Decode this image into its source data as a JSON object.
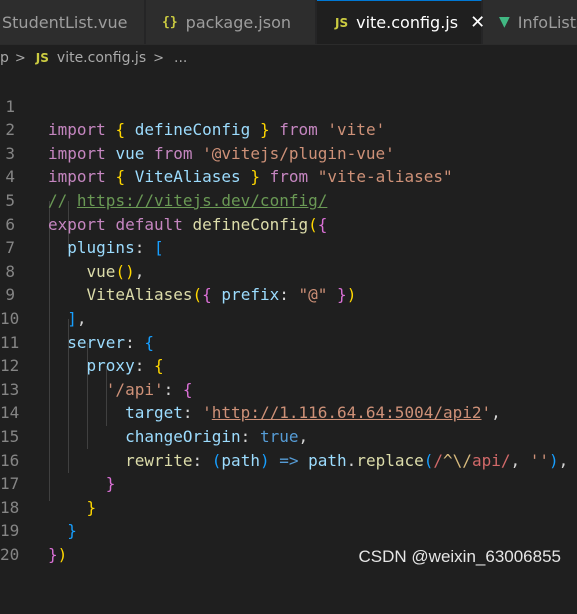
{
  "tabs": [
    {
      "label": "StudentList.vue",
      "icon": "vue-file-icon"
    },
    {
      "label": "package.json",
      "icon": "json-file-icon",
      "icon_glyph": "{}"
    },
    {
      "label": "vite.config.js",
      "icon": "js-file-icon",
      "icon_glyph": "JS",
      "active": true
    },
    {
      "label": "InfoLists",
      "icon": "vue-file-icon"
    }
  ],
  "close_glyph": "✕",
  "breadcrumb": {
    "folder": "p",
    "file_icon_glyph": "JS",
    "file": "vite.config.js",
    "more": "..."
  },
  "line_numbers": [
    "1",
    "2",
    "3",
    "4",
    "5",
    "6",
    "7",
    "8",
    "9",
    "10",
    "11",
    "12",
    "13",
    "14",
    "15",
    "16",
    "17",
    "18",
    "19",
    "20"
  ],
  "code": {
    "l1": [
      "import",
      "{",
      "defineConfig",
      "}",
      "from",
      "'vite'"
    ],
    "l2": [
      "import",
      "vue",
      "from",
      "'@vitejs/plugin-vue'"
    ],
    "l3": [
      "import",
      "{",
      "ViteAliases",
      "}",
      "from",
      "\"vite-aliases\""
    ],
    "l4": [
      "// ",
      "https://vitejs.dev/config/"
    ],
    "l5": [
      "export",
      "default",
      "defineConfig",
      "(",
      "{"
    ],
    "l6": [
      "plugins",
      ":",
      "["
    ],
    "l7": [
      "vue",
      "(",
      ")",
      ","
    ],
    "l8": [
      "ViteAliases",
      "(",
      "{",
      "prefix",
      ":",
      "\"@\"",
      "}",
      ")"
    ],
    "l9": [
      "]",
      ","
    ],
    "l10": [
      "server",
      ":",
      "{"
    ],
    "l11": [
      "proxy",
      ":",
      "{"
    ],
    "l12": [
      "'/api'",
      ":",
      "{"
    ],
    "l13": [
      "target",
      ":",
      "'",
      "http://1.116.64.64:5004/api2",
      "'",
      ","
    ],
    "l14": [
      "changeOrigin",
      ":",
      "true",
      ","
    ],
    "l15": [
      "rewrite",
      ":",
      "(",
      "path",
      ")",
      "=>",
      "path",
      ".",
      "replace",
      "(",
      "/",
      "^",
      "\\/",
      "api",
      "/",
      ",",
      "''",
      ")",
      ","
    ],
    "l16": [
      "}"
    ],
    "l17": [
      "}"
    ],
    "l18": [
      "}"
    ],
    "l19": [
      "}",
      ")"
    ]
  },
  "watermark": "CSDN @weixin_63006855",
  "colors": {
    "editor_bg": "#1f1f1f",
    "keyword": "#c586c0",
    "string": "#ce9178",
    "function": "#dcdcaa",
    "variable": "#9cdcfe",
    "comment": "#6a9955",
    "bracket_gold": "#ffd700",
    "bracket_orchid": "#da70d6",
    "bracket_blue": "#179fff"
  }
}
